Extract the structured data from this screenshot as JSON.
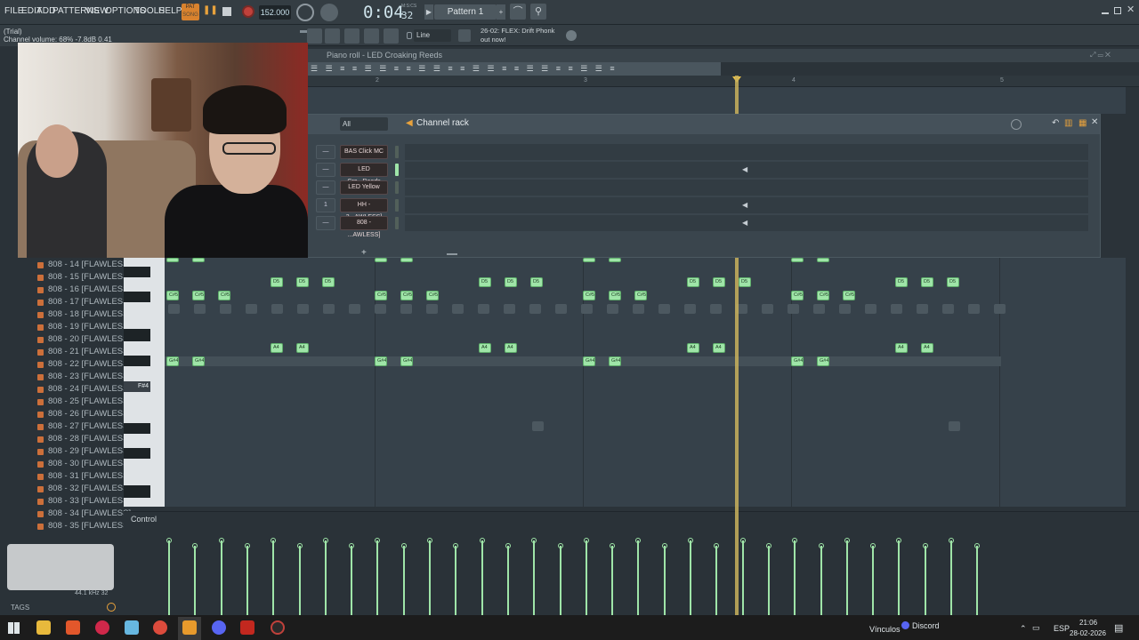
{
  "menu": [
    "FILE",
    "EDIT",
    "ADD",
    "PATTERNS",
    "VIEW",
    "OPTIONS",
    "TOOLS",
    "HELP"
  ],
  "transport": {
    "mode": "PAT",
    "song": "SONG",
    "tempo": "152.000",
    "time": "0:04",
    "time_sub": "32",
    "time_unit": "M:S:CS",
    "pattern": "Pattern 1"
  },
  "hint": {
    "line1": "(Trial)",
    "line2": "Channel volume: 68%  -7.8dB  0.41"
  },
  "snap": "Line",
  "news": {
    "line1": "26-02: FLEX: Drift Phonk",
    "line2": "out now!"
  },
  "piano_roll_title": "Piano roll - LED Croaking Reeds",
  "ruler": [
    "2",
    "3",
    "4",
    "5"
  ],
  "channel_rack": {
    "filter": "All",
    "title": "Channel rack",
    "channels": [
      {
        "num": "—",
        "name": "BAS Click MC"
      },
      {
        "num": "—",
        "name": "LED Cro...Reeds"
      },
      {
        "num": "—",
        "name": "LED Yellow"
      },
      {
        "num": "1",
        "name": "HH - 3...AWLESS]"
      },
      {
        "num": "—",
        "name": "808 - ...AWLESS]"
      }
    ]
  },
  "browser_items": [
    "808 - 14 [FLAWLESS]",
    "808 - 15 [FLAWLESS]",
    "808 - 16 [FLAWLESS]",
    "808 - 17 [FLAWLESS]",
    "808 - 18 [FLAWLESS]",
    "808 - 19 [FLAWLESS]",
    "808 - 20 [FLAWLESS]",
    "808 - 21 [FLAWLESS]",
    "808 - 22 [FLAWLESS]",
    "808 - 23 [FLAWLESS]",
    "808 - 24 [FLAWLESS]",
    "808 - 25 [FLAWLESS]",
    "808 - 26 [FLAWLESS]",
    "808 - 27 [FLAWLESS]",
    "808 - 28 [FLAWLESS]",
    "808 - 29 [FLAWLESS]",
    "808 - 30 [FLAWLESS]",
    "808 - 31 [FLAWLESS]",
    "808 - 32 [FLAWLESS]",
    "808 - 33 [FLAWLESS]",
    "808 - 34 [FLAWLESS]",
    "808 - 35 [FLAWLESS]"
  ],
  "key_label": "F#4",
  "notes": {
    "d5": "D5",
    "cs5": "C#5",
    "a4": "A4",
    "gs4": "G#4"
  },
  "control_label": "Control",
  "sample_info": "44.1 kHz 32",
  "tags_label": "TAGS",
  "taskbar": {
    "vinculos": "Vínculos",
    "discord": "Discord",
    "lang": "ESP",
    "time": "21:06",
    "date": "28-02-2026"
  }
}
